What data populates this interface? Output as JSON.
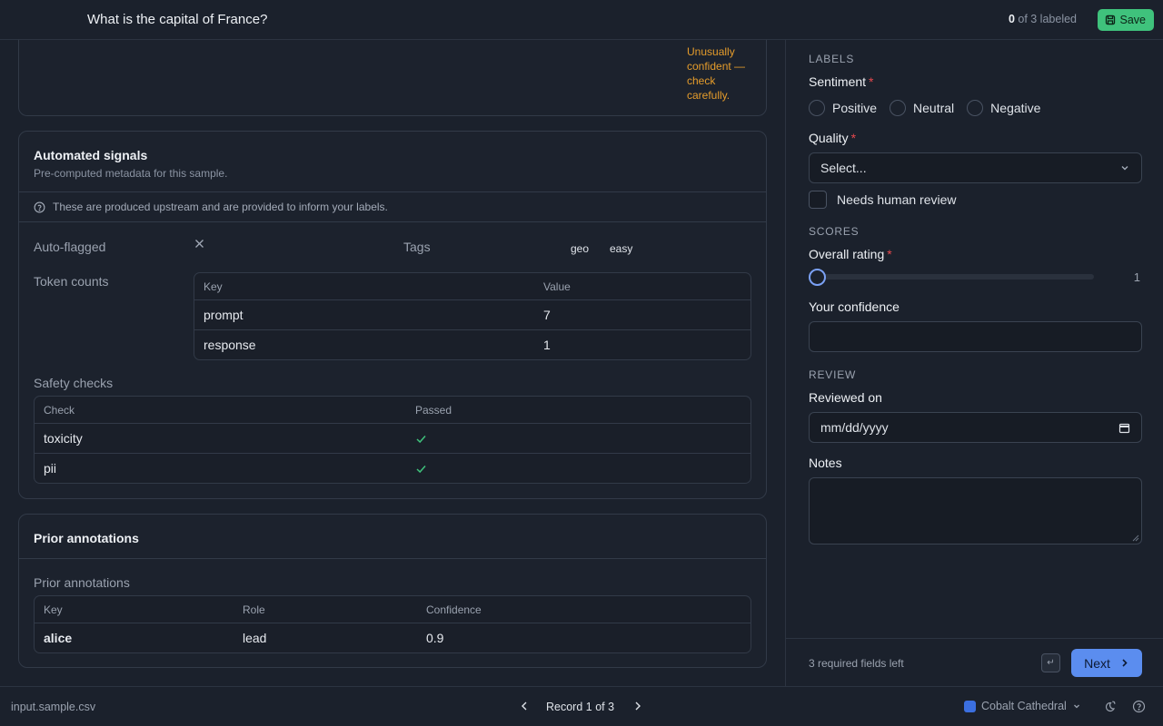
{
  "header": {
    "question": "What is the capital of France?",
    "labeled_count": "0",
    "labeled_suffix": " of 3 labeled",
    "save_label": "Save"
  },
  "prompt_card": {
    "warning": "Unusually confident — check carefully."
  },
  "signals": {
    "title": "Automated signals",
    "subtitle": "Pre-computed metadata for this sample.",
    "info": "These are produced upstream and are provided to inform your labels.",
    "auto_flagged_label": "Auto-flagged",
    "tags_label": "Tags",
    "tags": [
      "geo",
      "easy"
    ],
    "token_counts_label": "Token counts",
    "token_table": {
      "headers": [
        "Key",
        "Value"
      ],
      "rows": [
        [
          "prompt",
          "7"
        ],
        [
          "response",
          "1"
        ]
      ]
    },
    "safety_label": "Safety checks",
    "safety_table": {
      "headers": [
        "Check",
        "Passed"
      ],
      "rows": [
        [
          "toxicity",
          true
        ],
        [
          "pii",
          true
        ]
      ]
    }
  },
  "prior": {
    "title": "Prior annotations",
    "section_label": "Prior annotations",
    "table": {
      "headers": [
        "Key",
        "Role",
        "Confidence"
      ],
      "rows": [
        [
          "alice",
          "lead",
          "0.9"
        ]
      ]
    }
  },
  "form": {
    "labels_section": "LABELS",
    "sentiment_label": "Sentiment",
    "sentiment_options": [
      "Positive",
      "Neutral",
      "Negative"
    ],
    "quality_label": "Quality",
    "quality_placeholder": "Select...",
    "needs_review_label": "Needs human review",
    "scores_section": "SCORES",
    "rating_label": "Overall rating",
    "rating_value": "1",
    "rating_fraction": 0,
    "confidence_label": "Your confidence",
    "review_section": "REVIEW",
    "reviewed_on_label": "Reviewed on",
    "date_placeholder": "mm/dd/yyyy",
    "notes_label": "Notes",
    "required_left": "3 required fields left",
    "enter_key": "↵",
    "next_label": "Next"
  },
  "statusbar": {
    "file": "input.sample.csv",
    "record": "Record 1 of 3",
    "theme_name": "Cobalt Cathedral",
    "theme_color": "#3b6fe0"
  },
  "colors": {
    "accent": "#5b8def",
    "success": "#3fc27c",
    "warning": "#e59c2b",
    "required": "#e5484d"
  }
}
